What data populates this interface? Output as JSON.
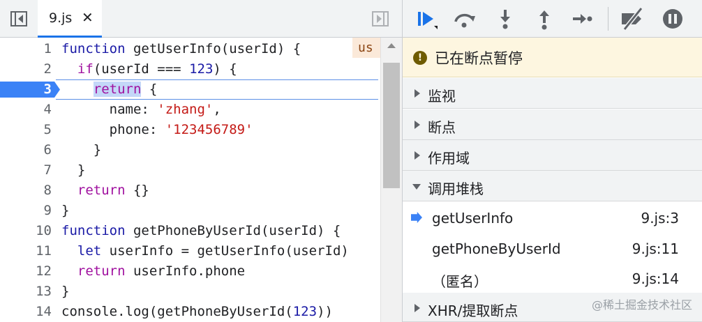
{
  "editor": {
    "tab_label": "9.js",
    "tab_close": "✕",
    "inline_hint": "us",
    "lines": [
      {
        "n": "1",
        "tokens": [
          [
            "kw2",
            "function"
          ],
          [
            "fn",
            " getUserInfo(userId) {"
          ]
        ]
      },
      {
        "n": "2",
        "tokens": [
          [
            "fn",
            "  "
          ],
          [
            "kw",
            "if"
          ],
          [
            "fn",
            "(userId === "
          ],
          [
            "num",
            "123"
          ],
          [
            "fn",
            ") {"
          ]
        ]
      },
      {
        "n": "3",
        "tokens": [
          [
            "fn",
            "    "
          ],
          [
            "kwhl",
            "return"
          ],
          [
            "fn",
            " {"
          ]
        ]
      },
      {
        "n": "4",
        "tokens": [
          [
            "fn",
            "      name: "
          ],
          [
            "str",
            "'zhang'"
          ],
          [
            "fn",
            ","
          ]
        ]
      },
      {
        "n": "5",
        "tokens": [
          [
            "fn",
            "      phone: "
          ],
          [
            "str",
            "'123456789'"
          ]
        ]
      },
      {
        "n": "6",
        "tokens": [
          [
            "fn",
            "    }"
          ]
        ]
      },
      {
        "n": "7",
        "tokens": [
          [
            "fn",
            "  }"
          ]
        ]
      },
      {
        "n": "8",
        "tokens": [
          [
            "fn",
            "  "
          ],
          [
            "kw",
            "return"
          ],
          [
            "fn",
            " {}"
          ]
        ]
      },
      {
        "n": "9",
        "tokens": [
          [
            "fn",
            "}"
          ]
        ]
      },
      {
        "n": "10",
        "tokens": [
          [
            "kw2",
            "function"
          ],
          [
            "fn",
            " getPhoneByUserId(userId) {"
          ]
        ]
      },
      {
        "n": "11",
        "tokens": [
          [
            "fn",
            "  "
          ],
          [
            "kw2",
            "let"
          ],
          [
            "fn",
            " userInfo = getUserInfo(userId)"
          ]
        ]
      },
      {
        "n": "12",
        "tokens": [
          [
            "fn",
            "  "
          ],
          [
            "kw",
            "return"
          ],
          [
            "fn",
            " userInfo.phone"
          ]
        ]
      },
      {
        "n": "13",
        "tokens": [
          [
            "fn",
            "}"
          ]
        ]
      },
      {
        "n": "14",
        "tokens": [
          [
            "fn",
            "console.log(getPhoneByUserId("
          ],
          [
            "num",
            "123"
          ],
          [
            "fn",
            "))"
          ]
        ]
      }
    ],
    "active_line": "3"
  },
  "debugger": {
    "paused_icon": "!",
    "paused_text": "已在断点暂停",
    "sections": {
      "watch": "监视",
      "breakpoints": "断点",
      "scope": "作用域",
      "call_stack": "调用堆栈",
      "xhr": "XHR/提取断点"
    },
    "call_stack": [
      {
        "name": "getUserInfo",
        "loc": "9.js:3"
      },
      {
        "name": "getPhoneByUserId",
        "loc": "9.js:11"
      },
      {
        "name": "（匿名）",
        "loc": "9.js:14"
      }
    ]
  },
  "icons": {
    "resume": "resume-icon",
    "step_over": "step-over-icon",
    "step_into": "step-into-icon",
    "step_out": "step-out-icon",
    "step": "step-icon",
    "deactivate": "deactivate-breakpoints-icon",
    "pause_exceptions": "pause-on-exceptions-icon"
  },
  "colors": {
    "accent": "#1a73e8",
    "breakpoint": "#3b82f6",
    "paused_bg": "#fdf6e0"
  },
  "watermark": "@稀土掘金技术社区"
}
